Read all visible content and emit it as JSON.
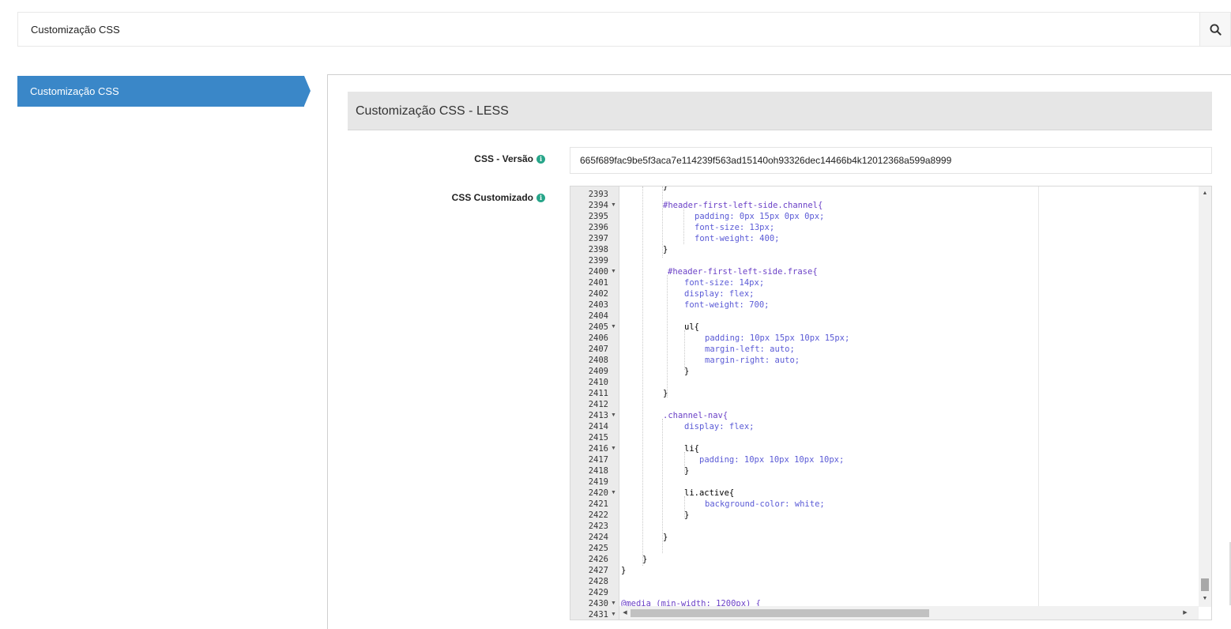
{
  "topbar": {
    "title": "Customização CSS"
  },
  "sidebar": {
    "items": [
      {
        "label": "Customização CSS",
        "active": true
      }
    ]
  },
  "section": {
    "header": "Customização CSS - LESS"
  },
  "form": {
    "version_label": "CSS - Versão",
    "version_value": "665f689fac9be5f3aca7e114239f563ad15140oh93326dec14466b4k12012368a599a8999",
    "custom_label": "CSS Customizado"
  },
  "colors": {
    "accent": "#3a87c8",
    "info": "#27a589",
    "header_bg": "#e6e6e6"
  },
  "editor": {
    "lines": [
      {
        "n": "2393",
        "fold": false
      },
      {
        "n": "2394",
        "fold": true
      },
      {
        "n": "2395",
        "fold": false
      },
      {
        "n": "2396",
        "fold": false
      },
      {
        "n": "2397",
        "fold": false
      },
      {
        "n": "2398",
        "fold": false
      },
      {
        "n": "2399",
        "fold": false
      },
      {
        "n": "2400",
        "fold": true
      },
      {
        "n": "2401",
        "fold": false
      },
      {
        "n": "2402",
        "fold": false
      },
      {
        "n": "2403",
        "fold": false
      },
      {
        "n": "2404",
        "fold": false
      },
      {
        "n": "2405",
        "fold": true
      },
      {
        "n": "2406",
        "fold": false
      },
      {
        "n": "2407",
        "fold": false
      },
      {
        "n": "2408",
        "fold": false
      },
      {
        "n": "2409",
        "fold": false
      },
      {
        "n": "2410",
        "fold": false
      },
      {
        "n": "2411",
        "fold": false
      },
      {
        "n": "2412",
        "fold": false
      },
      {
        "n": "2413",
        "fold": true
      },
      {
        "n": "2414",
        "fold": false
      },
      {
        "n": "2415",
        "fold": false
      },
      {
        "n": "2416",
        "fold": true
      },
      {
        "n": "2417",
        "fold": false
      },
      {
        "n": "2418",
        "fold": false
      },
      {
        "n": "2419",
        "fold": false
      },
      {
        "n": "2420",
        "fold": true
      },
      {
        "n": "2421",
        "fold": false
      },
      {
        "n": "2422",
        "fold": false
      },
      {
        "n": "2423",
        "fold": false
      },
      {
        "n": "2424",
        "fold": false
      },
      {
        "n": "2425",
        "fold": false
      },
      {
        "n": "2426",
        "fold": false
      },
      {
        "n": "2427",
        "fold": false
      },
      {
        "n": "2428",
        "fold": false
      },
      {
        "n": "2429",
        "fold": false
      },
      {
        "n": "2430",
        "fold": true
      },
      {
        "n": "2431",
        "fold": true
      }
    ],
    "code": [
      "}",
      "#header-first-left-side.channel{",
      "padding: 0px 15px 0px 0px;",
      "font-size: 13px;",
      "font-weight: 400;",
      "}",
      "#header-first-left-side.frase{",
      "font-size: 14px;",
      "display: flex;",
      "font-weight: 700;",
      "ul{",
      "padding: 10px 15px 10px 15px;",
      "margin-left: auto;",
      "margin-right: auto;",
      "}",
      "}",
      ".channel-nav{",
      "display: flex;",
      "li{",
      "padding: 10px 10px 10px 10px;",
      "}",
      "li.active{",
      "background-color: white;",
      "}",
      "}",
      "}",
      "}",
      "@media (min-width: 1200px) {"
    ]
  }
}
